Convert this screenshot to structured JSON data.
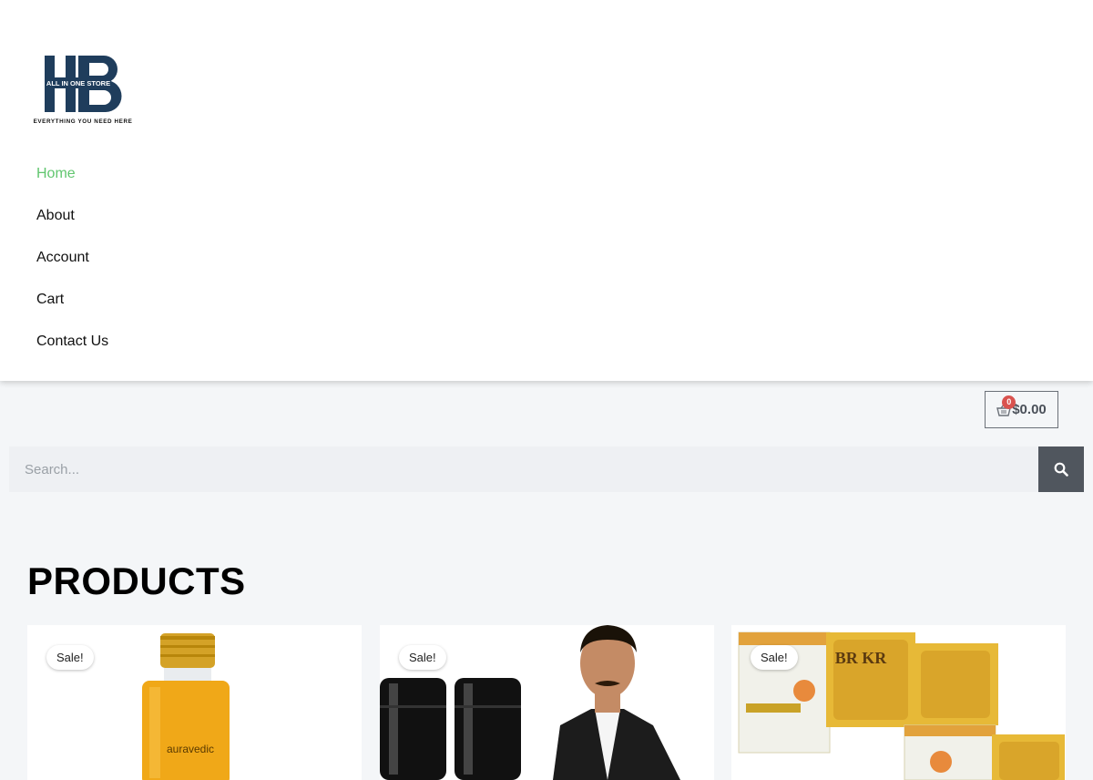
{
  "logo": {
    "mark": "HB",
    "banner_text": "ALL IN ONE STORE",
    "tagline": "EVERYTHING YOU NEED HERE",
    "brand_color": "#1f3d5c"
  },
  "nav": {
    "items": [
      {
        "label": "Home",
        "active": true
      },
      {
        "label": "About",
        "active": false
      },
      {
        "label": "Account",
        "active": false
      },
      {
        "label": "Cart",
        "active": false
      },
      {
        "label": "Contact Us",
        "active": false
      }
    ]
  },
  "cart": {
    "icon": "basket-icon",
    "count": "0",
    "total": "$0.00"
  },
  "search": {
    "placeholder": "Search...",
    "icon": "search-icon"
  },
  "products": {
    "heading": "PRODUCTS",
    "items": [
      {
        "badge": "Sale!",
        "image_text": "auravedic"
      },
      {
        "badge": "Sale!"
      },
      {
        "badge": "Sale!",
        "image_text": "BR KR"
      }
    ]
  },
  "colors": {
    "accent": "#61c66f",
    "badge": "#d9534f",
    "search_button": "#50565e",
    "page_bg": "#f4f6f8"
  }
}
